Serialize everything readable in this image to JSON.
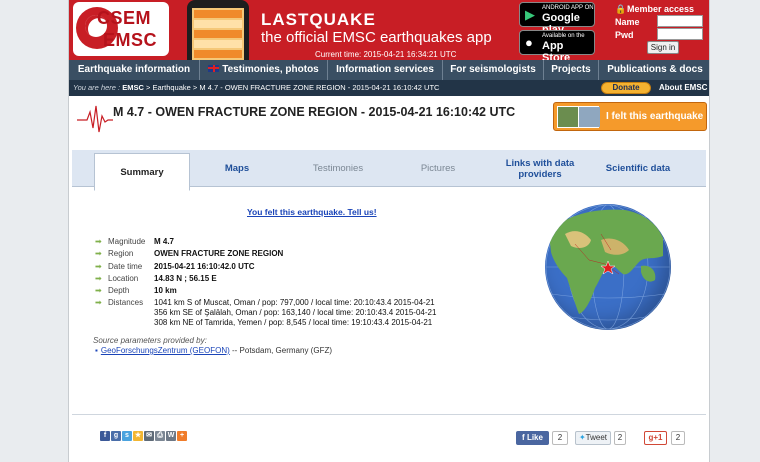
{
  "header": {
    "logo_line1": "CSEM",
    "logo_line2": "EMSC",
    "app_title": "LASTQUAKE",
    "app_subtitle": "the official EMSC earthquakes app",
    "current_time": "Current time: 2015-04-21 16:34:21 UTC",
    "google_play_small": "ANDROID APP ON",
    "google_play_big": "Google play",
    "app_store_small": "Available on the",
    "app_store_big": "App Store"
  },
  "member": {
    "title": "Member access",
    "name_label": "Name",
    "pwd_label": "Pwd",
    "name_value": "",
    "pwd_value": "",
    "signin_label": "Sign in"
  },
  "nav": {
    "items": [
      {
        "label": "Earthquake information"
      },
      {
        "label": "Testimonies, photos"
      },
      {
        "label": "Information services"
      },
      {
        "label": "For seismologists"
      },
      {
        "label": "Projects"
      },
      {
        "label": "Publications & docs"
      }
    ]
  },
  "breadcrumb": {
    "prefix": "You are here :",
    "emsc": "EMSC",
    "sep1": " > ",
    "earthquake": "Earthquake",
    "sep2": " > ",
    "current": "M 4.7 - OWEN FRACTURE ZONE REGION - 2015-04-21 16:10:42 UTC",
    "donate": "Donate",
    "about": "About EMSC"
  },
  "event": {
    "title": "M 4.7 - OWEN FRACTURE ZONE REGION - 2015-04-21 16:10:42 UTC",
    "felt_button": "I felt this earthquake",
    "felt_link": "You felt this earthquake. Tell us!"
  },
  "tabs": [
    {
      "label": "Summary",
      "active": true
    },
    {
      "label": "Maps"
    },
    {
      "label": "Testimonies"
    },
    {
      "label": "Pictures"
    },
    {
      "label": "Links with data providers"
    },
    {
      "label": "Scientific data"
    }
  ],
  "details": {
    "magnitude_label": "Magnitude",
    "magnitude": "M 4.7",
    "region_label": "Region",
    "region": "OWEN FRACTURE ZONE REGION",
    "datetime_label": "Date time",
    "datetime": "2015-04-21 16:10:42.0 UTC",
    "location_label": "Location",
    "location": "14.83 N ; 56.15 E",
    "depth_label": "Depth",
    "depth": "10 km",
    "distances_label": "Distances",
    "distances": [
      "1041 km S of Muscat, Oman / pop: 797,000 / local time: 20:10:43.4 2015-04-21",
      "356 km SE of Şalālah, Oman / pop: 163,140 / local time: 20:10:43.4 2015-04-21",
      "308 km NE of Tamrida, Yemen / pop: 8,545 / local time: 19:10:43.4 2015-04-21"
    ]
  },
  "source": {
    "heading": "Source parameters provided by:",
    "provider": "GeoForschungsZentrum (GEOFON)",
    "suffix": " -- Potsdam, Germany (GFZ)"
  },
  "social": {
    "like_label": "Like",
    "like_count": "2",
    "tweet_label": "Tweet",
    "tweet_count": "2",
    "gplus_label": "g+1",
    "gplus_count": "2"
  },
  "colors": {
    "brand_red": "#c81e25",
    "nav_bg": "#3a4f63",
    "link_blue": "#1a44b8",
    "felt_orange": "#f59a2b"
  }
}
